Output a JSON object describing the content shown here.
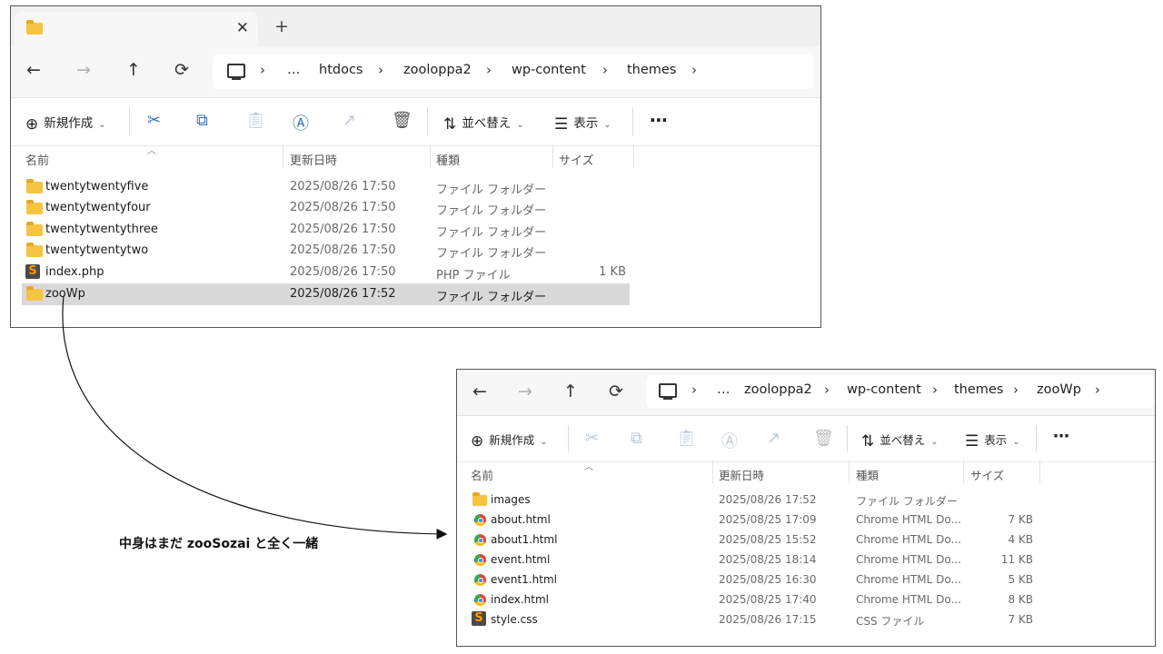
{
  "win1": {
    "tab": {
      "title": "",
      "close": "✕",
      "new": "+"
    },
    "nav": {
      "back": "←",
      "forward": "→",
      "up": "↑",
      "refresh": "⟳"
    },
    "breadcrumb": [
      "…",
      "htdocs",
      "zooloppa2",
      "wp-content",
      "themes"
    ],
    "toolbar": {
      "new_label": "新規作成",
      "sort_label": "並べ替え",
      "view_label": "表示",
      "more": "⋯"
    },
    "columns": [
      "名前",
      "更新日時",
      "種類",
      "サイズ"
    ],
    "rows": [
      {
        "icon": "folder-icon",
        "name": "twentytwentyfive",
        "date": "2025/08/26 17:50",
        "type": "ファイル フォルダー",
        "size": ""
      },
      {
        "icon": "folder-icon",
        "name": "twentytwentyfour",
        "date": "2025/08/26 17:50",
        "type": "ファイル フォルダー",
        "size": ""
      },
      {
        "icon": "folder-icon",
        "name": "twentytwentythree",
        "date": "2025/08/26 17:50",
        "type": "ファイル フォルダー",
        "size": ""
      },
      {
        "icon": "folder-icon",
        "name": "twentytwentytwo",
        "date": "2025/08/26 17:50",
        "type": "ファイル フォルダー",
        "size": ""
      },
      {
        "icon": "sublime-file-icon",
        "name": "index.php",
        "date": "2025/08/26 17:50",
        "type": "PHP ファイル",
        "size": "1 KB"
      },
      {
        "icon": "folder-icon",
        "name": "zooWp",
        "date": "2025/08/26 17:52",
        "type": "ファイル フォルダー",
        "size": "",
        "selected": true
      }
    ]
  },
  "win2": {
    "nav": {
      "back": "←",
      "forward": "→",
      "up": "↑",
      "refresh": "⟳"
    },
    "breadcrumb": [
      "…",
      "zooloppa2",
      "wp-content",
      "themes",
      "zooWp"
    ],
    "toolbar": {
      "new_label": "新規作成",
      "sort_label": "並べ替え",
      "view_label": "表示",
      "more": "⋯"
    },
    "columns": [
      "名前",
      "更新日時",
      "種類",
      "サイズ"
    ],
    "rows": [
      {
        "icon": "folder-icon",
        "name": "images",
        "date": "2025/08/26 17:52",
        "type": "ファイル フォルダー",
        "size": ""
      },
      {
        "icon": "chrome-html-icon",
        "name": "about.html",
        "date": "2025/08/25 17:09",
        "type": "Chrome HTML Do...",
        "size": "7 KB"
      },
      {
        "icon": "chrome-html-icon",
        "name": "about1.html",
        "date": "2025/08/25 15:52",
        "type": "Chrome HTML Do...",
        "size": "4 KB"
      },
      {
        "icon": "chrome-html-icon",
        "name": "event.html",
        "date": "2025/08/25 18:14",
        "type": "Chrome HTML Do...",
        "size": "11 KB"
      },
      {
        "icon": "chrome-html-icon",
        "name": "event1.html",
        "date": "2025/08/25 16:30",
        "type": "Chrome HTML Do...",
        "size": "5 KB"
      },
      {
        "icon": "chrome-html-icon",
        "name": "index.html",
        "date": "2025/08/25 17:40",
        "type": "Chrome HTML Do...",
        "size": "8 KB"
      },
      {
        "icon": "sublime-file-icon",
        "name": "style.css",
        "date": "2025/08/26 17:15",
        "type": "CSS ファイル",
        "size": "7 KB"
      }
    ]
  },
  "annotation": "中身はまだ zooSozai と全く一緒",
  "colors": {
    "folder": "#f6c343",
    "selected_row": "#d9d9d9",
    "accent_icon": "#3a6fb5"
  }
}
